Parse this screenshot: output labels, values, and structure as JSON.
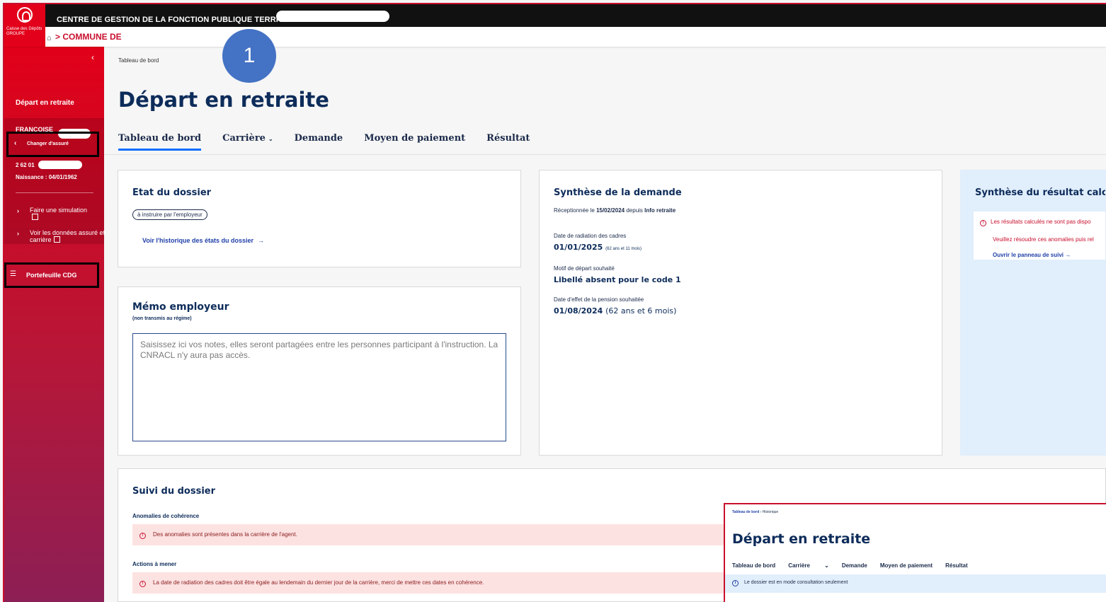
{
  "header": {
    "org_title": "CENTRE DE GESTION DE LA FONCTION PUBLIQUE TERRITORIALE",
    "logo_text": "Caisse des Dépôts GROUPE",
    "breadcrumb_commune": "> COMMUNE DE"
  },
  "sidebar": {
    "collapse_glyph": "‹",
    "section_title": "Départ en retraite",
    "insured_name": "FRANCOISE",
    "change_insured": "Changer d'assuré",
    "nir": "2 62 01",
    "birth": "Naissance : 04/01/1962",
    "links": [
      {
        "label": "Faire une simulation"
      },
      {
        "label": "Voir les données assuré et carrière"
      }
    ],
    "portfolio": "Portefeuille CDG"
  },
  "main": {
    "breadcrumb": "Tableau de bord",
    "step_number": "1",
    "title": "Départ en retraite",
    "tabs": [
      {
        "label": "Tableau de bord",
        "active": true
      },
      {
        "label": "Carrière",
        "dropdown": true
      },
      {
        "label": "Demande"
      },
      {
        "label": "Moyen de paiement"
      },
      {
        "label": "Résultat"
      }
    ]
  },
  "etat": {
    "title": "Etat du dossier",
    "status": "à instruire par l'employeur",
    "history_link": "Voir l'historique des états du dossier"
  },
  "memo": {
    "title": "Mémo employeur",
    "subtitle": "(non transmis au régime)",
    "placeholder": "Saisissez ici vos notes, elles seront partagées entre les personnes participant à l'instruction. La CNRACL n'y aura pas accès."
  },
  "synthese": {
    "title": "Synthèse de la demande",
    "received_prefix": "Réceptionnée le",
    "received_date": "15/02/2024",
    "received_mid": "depuis",
    "received_source": "Info retraite",
    "radiation_label": "Date de radiation des cadres",
    "radiation_value": "01/01/2025",
    "radiation_age": "(62 ans et 11 mois)",
    "motif_label": "Motif de départ souhaité",
    "motif_value": "Libellé absent pour le code 1",
    "effet_label": "Date d'effet de la pension souhaitée",
    "effet_value": "01/08/2024",
    "effet_age": "(62 ans et 6 mois)"
  },
  "resultat": {
    "title": "Synthèse du résultat calculé",
    "error": "Les résultats calculés ne sont pas dispo",
    "error2": "Veuillez résoudre ces anomalies puis rel",
    "link": "Ouvrir le panneau de suivi"
  },
  "suivi": {
    "title": "Suivi du dossier",
    "anomalies_label": "Anomalies de cohérence",
    "anomalies_text": "Des anomalies sont présentes dans la carrière de l'agent.",
    "actions_label": "Actions à mener",
    "actions_text": "La date de radiation des cadres doit être égale au lendemain du dernier jour de la carrière, merci de mettre ces dates en cohérence."
  },
  "inset": {
    "bc_link": "Tableau de bord",
    "bc_current": "Historique",
    "title": "Départ en retraite",
    "tabs": [
      "Tableau de bord",
      "Carrière",
      "Demande",
      "Moyen de paiement",
      "Résultat"
    ],
    "info": "Le dossier est en mode consultation seulement"
  },
  "colors": {
    "brand_red": "#e2001a",
    "navy": "#0d2c5a",
    "link_blue": "#1f3fa8",
    "step_badge": "#4472c4",
    "alert_bg": "#fde2e2",
    "info_bg": "#e1eefb"
  }
}
